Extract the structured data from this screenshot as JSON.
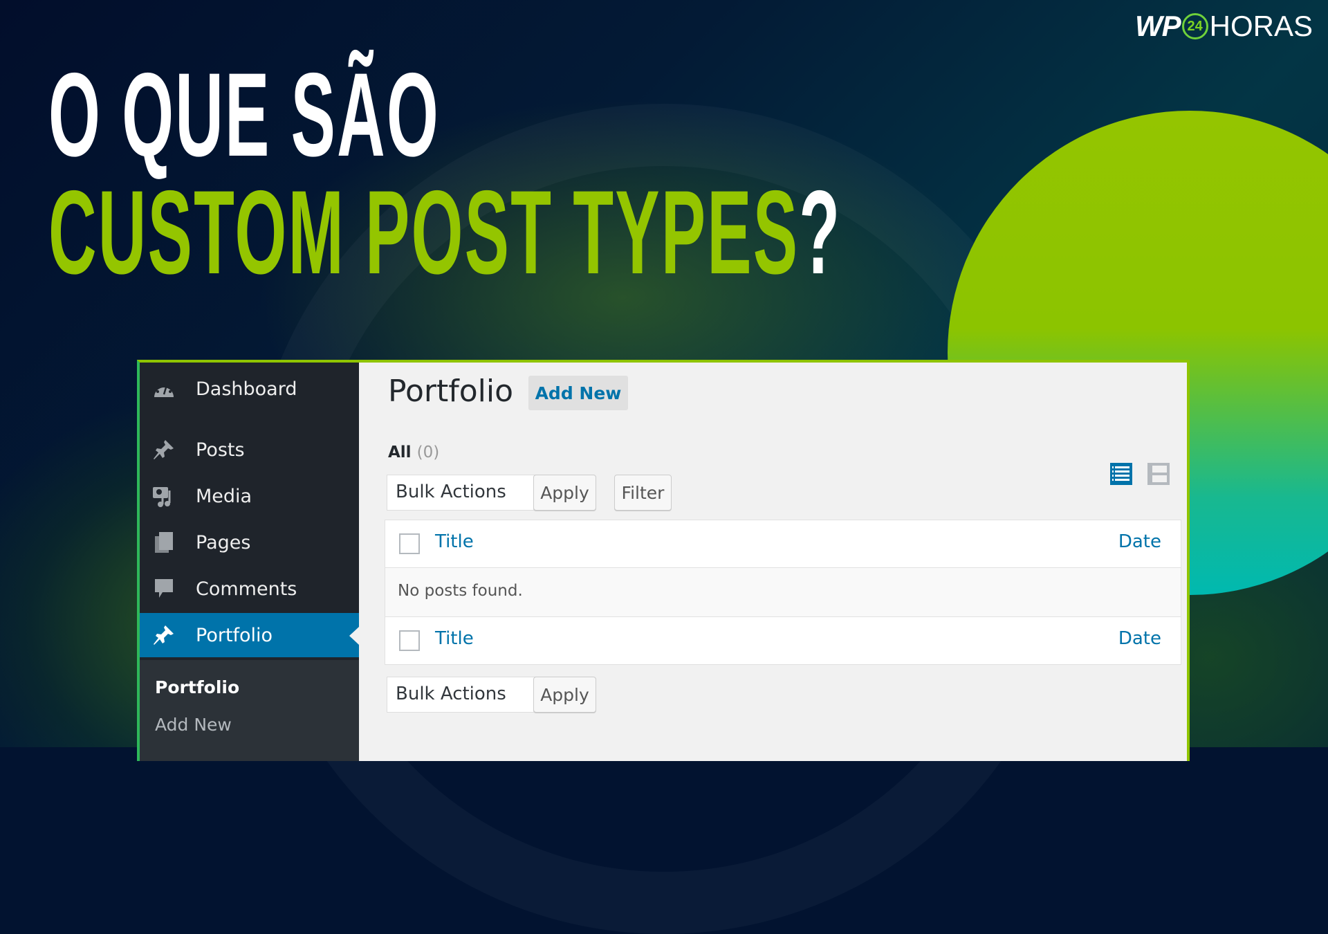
{
  "brand": {
    "logo_wp": "WP",
    "logo_badge": "24",
    "logo_horas": "HORAS"
  },
  "headline": {
    "line1": "O QUE SÃO",
    "line2": "CUSTOM POST TYPES",
    "line2_suffix": "?"
  },
  "colors": {
    "accent_green": "#94c500",
    "wp_blue": "#0073aa",
    "sidebar_bg": "#1f242b"
  },
  "sidebar": {
    "items": [
      {
        "label": "Dashboard",
        "icon": "dashboard-icon"
      },
      {
        "label": "Posts",
        "icon": "pushpin-icon"
      },
      {
        "label": "Media",
        "icon": "media-icon"
      },
      {
        "label": "Pages",
        "icon": "pages-icon"
      },
      {
        "label": "Comments",
        "icon": "comment-icon"
      },
      {
        "label": "Portfolio",
        "icon": "pushpin-icon",
        "active": true
      }
    ],
    "submenu": [
      {
        "label": "Portfolio",
        "current": true
      },
      {
        "label": "Add New"
      }
    ]
  },
  "main": {
    "title": "Portfolio",
    "add_new": "Add New",
    "filter_all_label": "All",
    "filter_all_count": "(0)",
    "top_toolbar": {
      "bulk_select": "Bulk Actions",
      "apply": "Apply",
      "filter": "Filter"
    },
    "view_modes": [
      "list-view-icon",
      "excerpt-view-icon"
    ],
    "table": {
      "columns": [
        "Title",
        "Date"
      ],
      "empty_message": "No posts found."
    },
    "bottom_toolbar": {
      "bulk_select": "Bulk Actions",
      "apply": "Apply"
    }
  }
}
